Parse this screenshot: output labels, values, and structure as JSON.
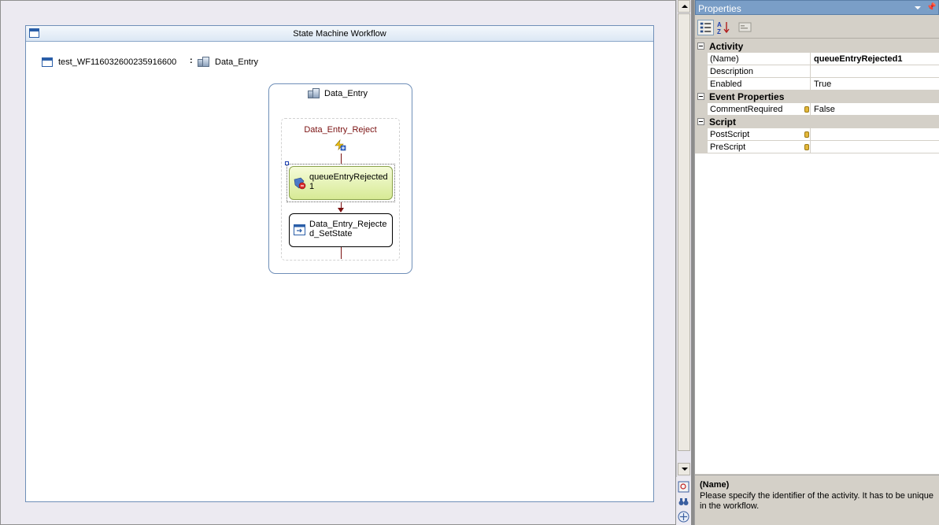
{
  "workflow": {
    "title": "State Machine Workflow",
    "name": "test_WF116032600235916600",
    "initial_state_separator": ":",
    "initial_state": "Data_Entry"
  },
  "state": {
    "title": "Data_Entry",
    "event_driven": {
      "title": "Data_Entry_Reject",
      "activities": [
        {
          "label": "queueEntryRejected1",
          "selected": true
        },
        {
          "label": "Data_Entry_Rejected_SetState"
        }
      ]
    }
  },
  "properties": {
    "title": "Properties",
    "categories": [
      {
        "label": "Activity",
        "rows": [
          {
            "name": "(Name)",
            "value": "queueEntryRejected1"
          },
          {
            "name": "Description",
            "value": ""
          },
          {
            "name": "Enabled",
            "value": "True"
          }
        ]
      },
      {
        "label": "Event Properties",
        "rows": [
          {
            "name": "CommentRequired",
            "value": "False"
          }
        ]
      },
      {
        "label": "Script",
        "rows": [
          {
            "name": "PostScript",
            "value": ""
          },
          {
            "name": "PreScript",
            "value": ""
          }
        ]
      }
    ],
    "description": {
      "title": "(Name)",
      "text": "Please specify the identifier of the activity. It has to be unique in the workflow."
    }
  },
  "icons": {
    "workflow": "workflow-window-icon",
    "state": "state-icon",
    "event": "event-driven-icon",
    "queue": "handle-external-event-icon",
    "setstate": "set-state-icon",
    "categorized": "categorized-view-icon",
    "alphabetical": "alphabetical-sort-icon",
    "property_pages": "property-pages-icon"
  },
  "colors": {
    "event_title": "#7a1010",
    "selected_activity_fill": "#d7ea95",
    "properties_titlebar": "#7a9ec7",
    "workflow_border": "#6f8fb8"
  }
}
